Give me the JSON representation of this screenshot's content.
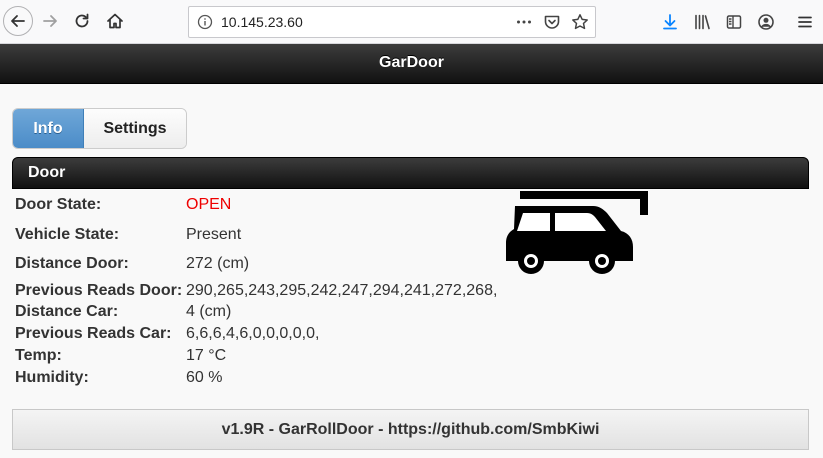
{
  "browser": {
    "url": "10.145.23.60",
    "icons": [
      "back-arrow-icon",
      "forward-arrow-icon",
      "reload-icon",
      "home-icon",
      "info-icon",
      "more-icon",
      "pocket-icon",
      "bookmark-star-icon",
      "download-icon",
      "library-icon",
      "sidebar-icon",
      "account-icon",
      "menu-icon"
    ]
  },
  "header": {
    "title": "GarDoor"
  },
  "tabs": [
    {
      "label": "Info",
      "active": true
    },
    {
      "label": "Settings",
      "active": false
    }
  ],
  "door_section": {
    "title": "Door",
    "rows": [
      {
        "label": "Door State:",
        "value": "OPEN"
      },
      {
        "label": "Vehicle State:",
        "value": "Present"
      },
      {
        "label": "Distance Door:",
        "value": "272 (cm)"
      },
      {
        "label": "Previous Reads Door:",
        "value": "290,265,243,295,242,247,294,241,272,268,"
      },
      {
        "label": "Distance Car:",
        "value": "4 (cm)"
      },
      {
        "label": "Previous Reads Car:",
        "value": "6,6,6,4,6,0,0,0,0,0,"
      },
      {
        "label": "Temp:",
        "value": "17 °C"
      },
      {
        "label": "Humidity:",
        "value": "60 %"
      }
    ],
    "graphic": "car-in-garage-open-door-icon"
  },
  "footer": {
    "text": "v1.9R - GarRollDoor - https://github.com/SmbKiwi"
  },
  "colors": {
    "open_state": "#ee0000",
    "active_tab": "#5a9bd5",
    "header_bg": "#1e1e1e"
  }
}
